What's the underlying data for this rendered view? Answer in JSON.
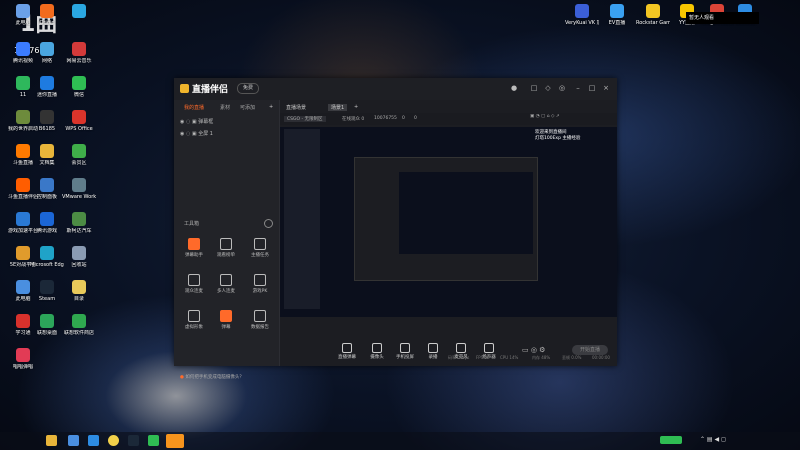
{
  "desktop": {
    "watermark": "1曲",
    "id_label": "10076755",
    "left_icons": [
      {
        "label": "此电脑",
        "color": "#6aa0e8"
      },
      {
        "label": "Origin",
        "color": "#f26b1d"
      },
      {
        "label": "",
        "color": "#2aa7e1"
      },
      {
        "label": "腾讯视频",
        "color": "#3b7cff"
      },
      {
        "label": "网络",
        "color": "#4aa6e0"
      },
      {
        "label": "网易云音乐",
        "color": "#d33a3a"
      },
      {
        "label": "11",
        "color": "#2eb85c"
      },
      {
        "label": "迷你直播",
        "color": "#1e7be0"
      },
      {
        "label": "微信",
        "color": "#2fbd53"
      },
      {
        "label": "我的世界启动",
        "color": "#6d8b3c"
      },
      {
        "label": "B6185",
        "color": "#333"
      },
      {
        "label": "WPS Office",
        "color": "#d9342b"
      },
      {
        "label": "斗鱼直播",
        "color": "#ff7a00"
      },
      {
        "label": "文档集",
        "color": "#e8b53a"
      },
      {
        "label": "会员区",
        "color": "#3fae49"
      },
      {
        "label": "斗鱼直播伴侣",
        "color": "#ff5d00"
      },
      {
        "label": "控制面板",
        "color": "#3a78c8"
      },
      {
        "label": "VMware Workstati...",
        "color": "#607d8b"
      },
      {
        "label": "游戏加速平台",
        "color": "#2a79d4"
      },
      {
        "label": "腾讯游戏",
        "color": "#1b66d6"
      },
      {
        "label": "斯柯达汽车",
        "color": "#4c8c44"
      },
      {
        "label": "5E对战平台",
        "color": "#e09b2c"
      },
      {
        "label": "Microsoft Edge",
        "color": "#1fa3c8"
      },
      {
        "label": "回收站",
        "color": "#8a9bb3"
      },
      {
        "label": "此电脑",
        "color": "#4a8fe0"
      },
      {
        "label": "Steam",
        "color": "#1b2838"
      },
      {
        "label": "目录",
        "color": "#e8c95a"
      },
      {
        "label": "学习通",
        "color": "#d8312c"
      },
      {
        "label": "联想桌面",
        "color": "#2ca65a"
      },
      {
        "label": "联想软件商店",
        "color": "#2fa84f"
      },
      {
        "label": "唱唱弹唱",
        "color": "#e23b55"
      }
    ],
    "top_right_icons": [
      {
        "label": "VeryKuai VK 加速器",
        "color": "#3b5fd8"
      },
      {
        "label": "EV直播",
        "color": "#3aa0f0"
      },
      {
        "label": "Rockstar Games...",
        "color": "#f3c623"
      },
      {
        "label": "YY直播",
        "color": "#f7c600"
      },
      {
        "label": "Google Chrome",
        "color": "#db4437"
      },
      {
        "label": "Connect",
        "color": "#2d8ce3"
      }
    ],
    "notification": "暂无人观看"
  },
  "app": {
    "logo": "直播伴侣",
    "version_pill": "免费",
    "title_buttons": [
      "gift-icon",
      "user-icon",
      "message-icon",
      "minimize-icon",
      "restore-icon",
      "close-icon"
    ],
    "left_tabs": [
      "我的直播",
      "素材",
      "可添加"
    ],
    "add_symbol": "+",
    "sources": [
      {
        "name": "弹幕框"
      },
      {
        "name": "全屏 1"
      }
    ],
    "tools_title": "工具箱",
    "tools": [
      {
        "label": "弹幕助手",
        "hot": true
      },
      {
        "label": "观看榜单",
        "hot": false
      },
      {
        "label": "主播任务",
        "hot": false
      },
      {
        "label": "观众连麦",
        "hot": false
      },
      {
        "label": "多人连麦",
        "hot": false
      },
      {
        "label": "游戏PK",
        "hot": false
      },
      {
        "label": "虚拟形象",
        "hot": false
      },
      {
        "label": "弹幕",
        "hot": true
      },
      {
        "label": "数据报告",
        "hot": false
      }
    ],
    "tip": "如何把手机变成电脑摄像头？",
    "scene_tabs": [
      "直播场景",
      "场景1",
      "+"
    ],
    "info": {
      "game": "CSGO - 无限制区",
      "online": "在线观众 0",
      "room_id": "10076755",
      "likes": "0",
      "gifts": "0"
    },
    "overlay": {
      "line1": "欢迎来到直播间",
      "line2": "灯塔100Exp 主播经验"
    },
    "bottom_buttons": [
      "直播弹幕",
      "摄像头",
      "手机投屏",
      "录播",
      "麦克风",
      "扬声器"
    ],
    "go_live": "开始直播",
    "status_text": [
      "码率 0kbps",
      "FPS 60",
      "CPU 14%",
      "内存 48%",
      "丢帧 0.0%",
      "00:00:00"
    ]
  }
}
